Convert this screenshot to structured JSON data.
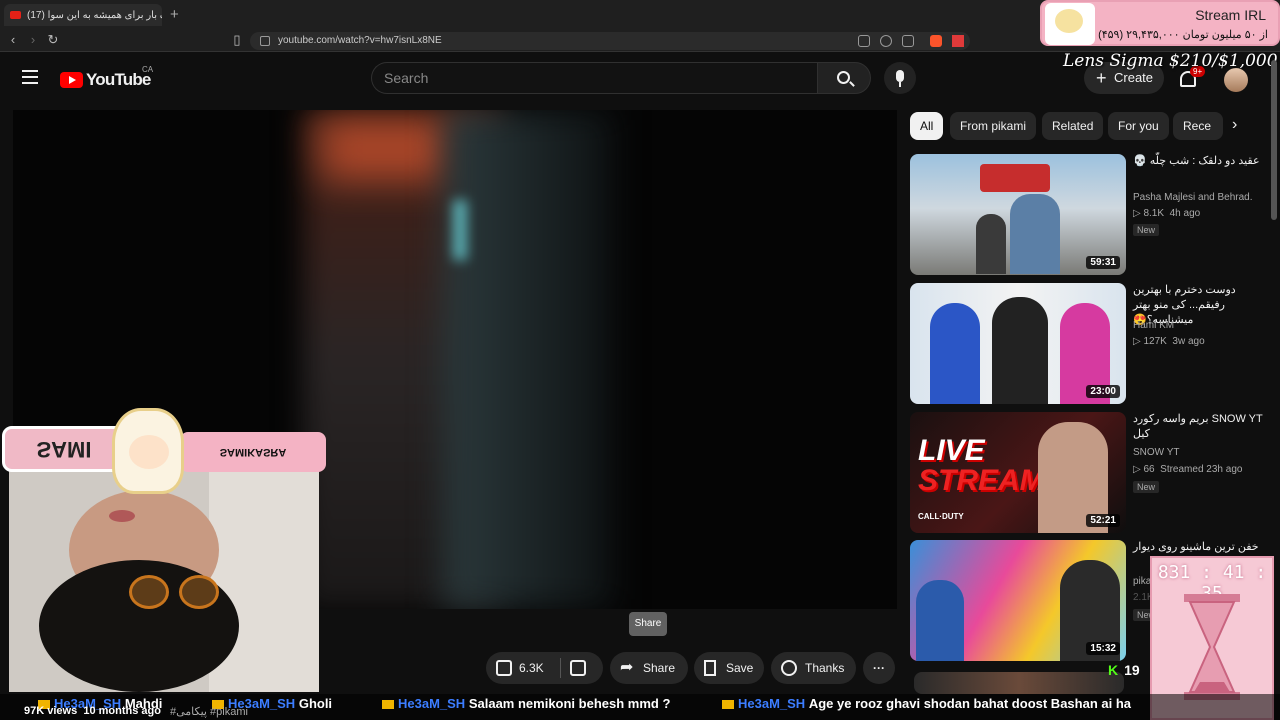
{
  "browser": {
    "tab_title": "(17) یک بار برای همیشه به این سوا",
    "tab_close": "×",
    "new_tab": "+",
    "url": "youtube.com/watch?v=hw7isnLx8NE"
  },
  "overlay": {
    "irl_title": "Stream IRL",
    "irl_goal": "(۴۵۹) ۲۹,۴۳۵,۰۰۰ از ۵۰ میلیون تومان",
    "lens_sigma": "Lens Sigma $210/$1,000",
    "cam_name": "SAMI",
    "social_handle": "SAMIKASRA",
    "timer": "831 : 41 : 35",
    "kick_count": "19",
    "kick_letter": "K"
  },
  "masthead": {
    "logo_text": "YouTube",
    "country": "CA",
    "search_placeholder": "Search",
    "create_label": "Create",
    "notif_count": "9+"
  },
  "player": {
    "tooltip": "Share",
    "likes": "6.3K",
    "share": "Share",
    "save": "Save",
    "thanks": "Thanks",
    "views": "97K views",
    "age": "10 months ago",
    "hashtag": "#پیکامی #pikami"
  },
  "chips": [
    "All",
    "From pikami",
    "Related",
    "For you",
    "Rece"
  ],
  "recommendations": [
    {
      "title": "عقید دو دلقک : شب چلّه 💀",
      "channel": "Pasha Majlesi and Behrad.",
      "views": "8.1K",
      "age": "4h ago",
      "badge": "New",
      "duration": "59:31"
    },
    {
      "title": "دوست دخترم با بهترین رفیقم... کی منو بهتر میشناسه؟😍",
      "channel": "Hami KM",
      "views": "127K",
      "age": "3w ago",
      "badge": "",
      "duration": "23:00"
    },
    {
      "title": "SNOW YT بریم واسه رکورد کیل",
      "channel": "SNOW YT",
      "views": "66",
      "age": "Streamed 23h ago",
      "badge": "New",
      "duration": "52:21"
    },
    {
      "title": "خفن ترین ماشینو روی دیوار",
      "channel": "pika",
      "views": "2.1K",
      "age": "",
      "badge": "New",
      "duration": "15:32"
    }
  ],
  "chat": [
    {
      "user": "He3aM_SH",
      "text": "Mahdi"
    },
    {
      "user": "He3aM_SH",
      "text": "Gholi"
    },
    {
      "user": "He3aM_SH",
      "text": "Salaam nemikoni behesh mmd ?"
    },
    {
      "user": "He3aM_SH",
      "text": "Age ye rooz ghavi shodan bahat doost Bashan ai ha"
    }
  ]
}
